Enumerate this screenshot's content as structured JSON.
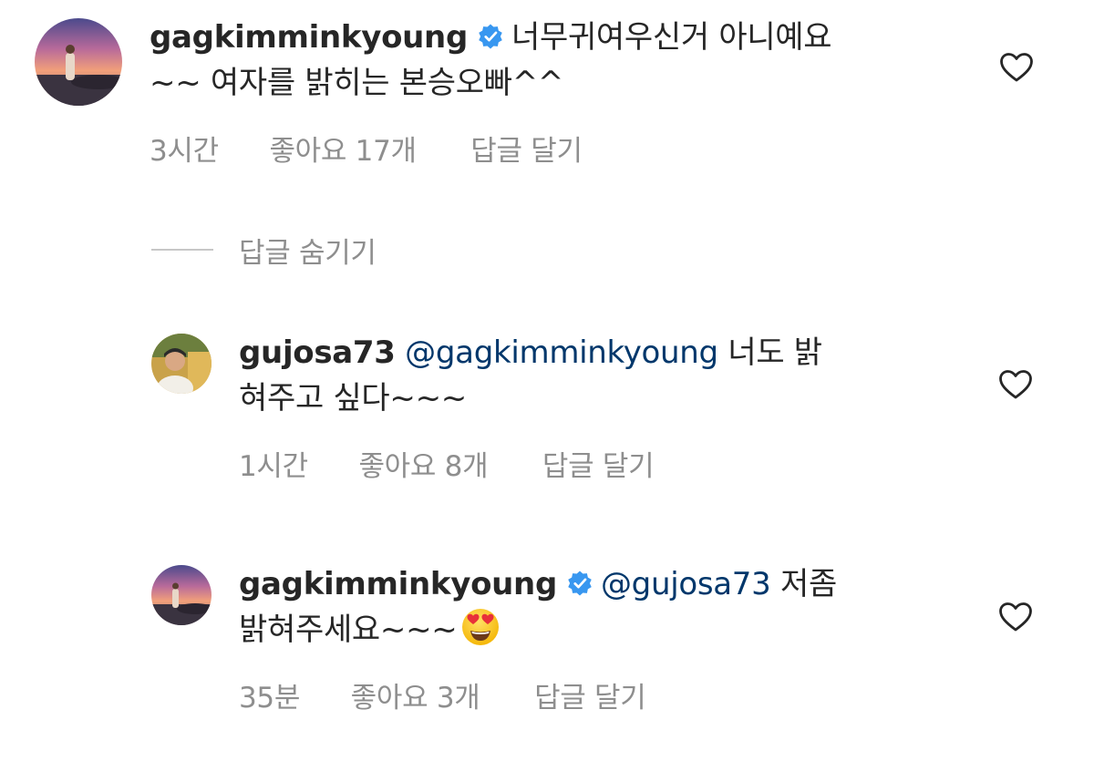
{
  "comments": [
    {
      "username": "gagkimminkyoung",
      "verified": true,
      "mention": "",
      "line1": "너무귀여우신거 아니예요",
      "line2": "~~ 여자를 밝히는 본승오빠^^",
      "time": "3시간",
      "likes": "좋아요 17개",
      "reply": "답글 달기"
    },
    {
      "username": "gujosa73",
      "verified": false,
      "mention": "@gagkimminkyoung",
      "line1": "너도 밝",
      "line2": "혀주고 싶다~~~",
      "time": "1시간",
      "likes": "좋아요 8개",
      "reply": "답글 달기"
    },
    {
      "username": "gagkimminkyoung",
      "verified": true,
      "mention": "@gujosa73",
      "line1": "저좀",
      "line2": "밝혀주세요~~~",
      "time": "35분",
      "likes": "좋아요 3개",
      "reply": "답글 달기"
    }
  ],
  "hide_replies_label": "답글 숨기기",
  "icons": {
    "verified": "verified-badge-icon",
    "like": "heart-icon",
    "emoji": "heart-eyes-emoji"
  },
  "colors": {
    "text": "#262626",
    "secondary": "#8e8e8e",
    "mention": "#00376b",
    "verified": "#3897f0"
  }
}
